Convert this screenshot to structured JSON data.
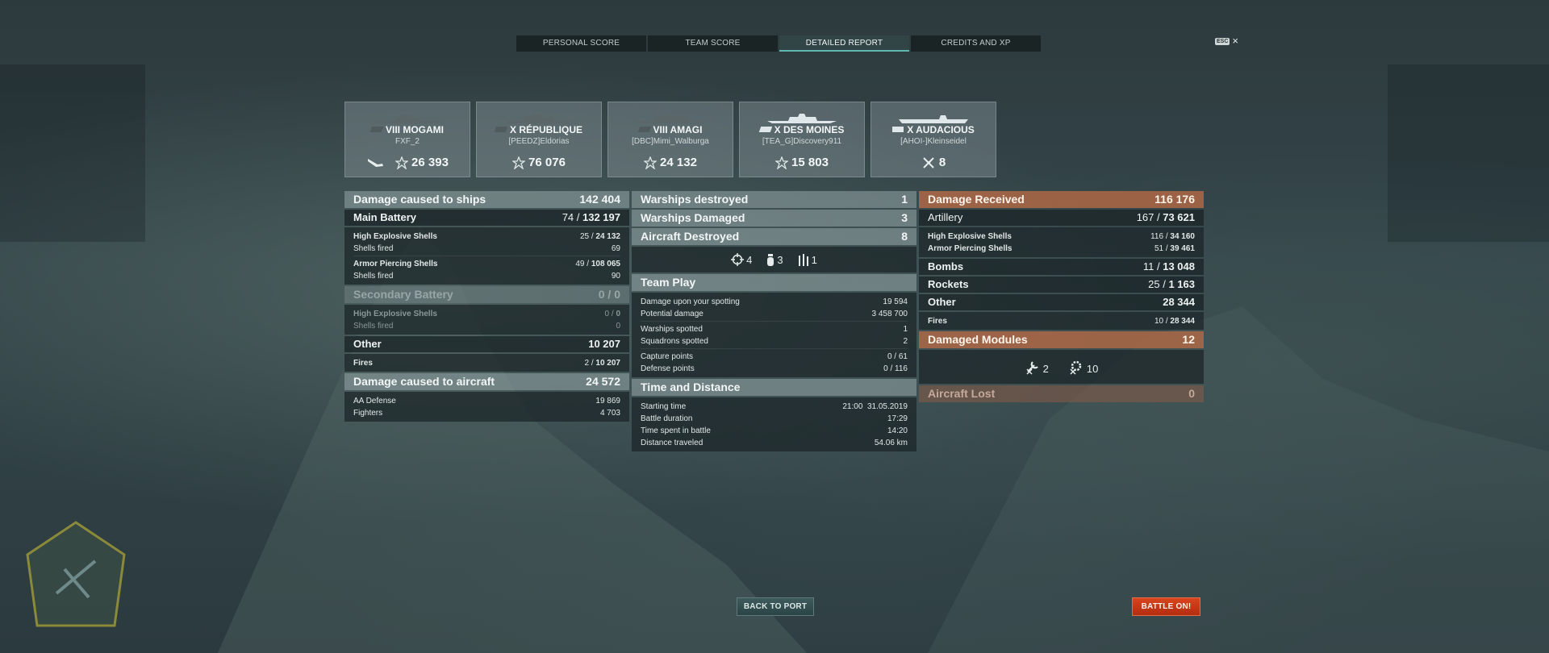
{
  "tabs": [
    {
      "label": "PERSONAL SCORE"
    },
    {
      "label": "TEAM SCORE"
    },
    {
      "label": "DETAILED REPORT"
    },
    {
      "label": "CREDITS AND XP"
    }
  ],
  "esc_key": "ESC",
  "close_glyph": "×",
  "ships": [
    {
      "name": "VIII MOGAMI",
      "player": "FXF_2",
      "prefix": "",
      "value": "26 393",
      "icon": "plane-icon"
    },
    {
      "name": "X RÉPUBLIQUE",
      "player": "[PEEDZ]Eldorias",
      "prefix": "",
      "value": "76 076",
      "icon": "ribbon-icon"
    },
    {
      "name": "VIII AMAGI",
      "player": "[DBC]Mimi_Walburga",
      "prefix": "",
      "value": "24 132",
      "icon": "ribbon-icon"
    },
    {
      "name": "X DES MOINES",
      "player": "[TEA_G]Discovery911",
      "prefix": "",
      "value": "15 803",
      "icon": "ribbon-icon"
    },
    {
      "name": "X AUDACIOUS",
      "player": "[AHOI-]Kleinseidel",
      "prefix": "",
      "value": "8",
      "icon": "plane-crossed-icon"
    }
  ],
  "dealt": {
    "title": "Damage caused to ships",
    "total": "142 404",
    "main": {
      "label": "Main Battery",
      "hits": "74",
      "dmg": "132 197"
    },
    "he": {
      "label": "High Explosive Shells",
      "hits": "25",
      "dmg": "24 132",
      "fired_label": "Shells fired",
      "fired": "69"
    },
    "ap": {
      "label": "Armor Piercing Shells",
      "hits": "49",
      "dmg": "108 065",
      "fired_label": "Shells fired",
      "fired": "90"
    },
    "secondary": {
      "label": "Secondary Battery",
      "hits": "0",
      "dmg": "0"
    },
    "sec_he": {
      "label": "High Explosive Shells",
      "hits": "0",
      "dmg": "0",
      "fired_label": "Shells fired",
      "fired": "0"
    },
    "other": {
      "label": "Other",
      "dmg": "10 207"
    },
    "fires": {
      "label": "Fires",
      "hits": "2",
      "dmg": "10 207"
    },
    "aircraft": {
      "title": "Damage caused to aircraft",
      "total": "24 572",
      "aa_label": "AA Defense",
      "aa": "19 869",
      "fighters_label": "Fighters",
      "fighters": "4 703"
    }
  },
  "mid": {
    "destroyed_label": "Warships destroyed",
    "destroyed": "1",
    "damaged_label": "Warships Damaged",
    "damaged": "3",
    "aircraft_label": "Aircraft Destroyed",
    "aircraft": "8",
    "icons": [
      {
        "icon": "crosshair-icon",
        "value": "4"
      },
      {
        "icon": "bomb-icon",
        "value": "3"
      },
      {
        "icon": "rocket-icon",
        "value": "1"
      }
    ],
    "team": {
      "title": "Team Play",
      "spot_dmg_label": "Damage upon your spotting",
      "spot_dmg": "19 594",
      "potential_label": "Potential damage",
      "potential": "3 458 700",
      "ships_spotted_label": "Warships spotted",
      "ships_spotted": "1",
      "sq_spotted_label": "Squadrons spotted",
      "sq_spotted": "2",
      "capture_label": "Capture points",
      "capture": "0 / 61",
      "defense_label": "Defense points",
      "defense": "0 / 116"
    },
    "time": {
      "title": "Time and Distance",
      "start_label": "Starting time",
      "start": "21:00  31.05.2019",
      "duration_label": "Battle duration",
      "duration": "17:29",
      "spent_label": "Time spent in battle",
      "spent": "14:20",
      "distance_label": "Distance traveled",
      "distance": "54.06 km"
    }
  },
  "received": {
    "title": "Damage Received",
    "total": "116 176",
    "artillery": {
      "label": "Artillery",
      "hits": "167",
      "dmg": "73 621"
    },
    "he": {
      "label": "High Explosive Shells",
      "hits": "116",
      "dmg": "34 160"
    },
    "ap": {
      "label": "Armor Piercing Shells",
      "hits": "51",
      "dmg": "39 461"
    },
    "bombs": {
      "label": "Bombs",
      "hits": "11",
      "dmg": "13 048"
    },
    "rockets": {
      "label": "Rockets",
      "hits": "25",
      "dmg": "1 163"
    },
    "other": {
      "label": "Other",
      "dmg": "28 344"
    },
    "fires": {
      "label": "Fires",
      "hits": "10",
      "dmg": "28 344"
    },
    "modules": {
      "title": "Damaged Modules",
      "total": "12",
      "items": [
        {
          "icon": "wrench-icon",
          "value": "2"
        },
        {
          "icon": "gear-crossed-icon",
          "value": "10"
        }
      ]
    },
    "aircraft_lost": {
      "title": "Aircraft Lost",
      "total": "0"
    }
  },
  "buttons": {
    "port": "BACK TO PORT",
    "battle": "BATTLE ON!"
  }
}
